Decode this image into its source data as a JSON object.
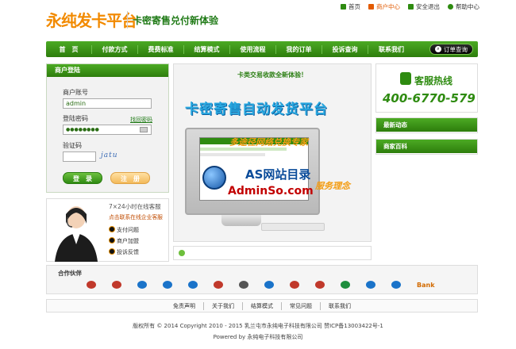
{
  "header": {
    "logo": "永纯发卡平台",
    "slogan": "卡密寄售兑付新体验",
    "links": [
      {
        "label": "首页",
        "icon": "home-icon",
        "color": "#2e8b10"
      },
      {
        "label": "商户中心",
        "icon": "user-icon",
        "color": "#e25a00"
      },
      {
        "label": "安全退出",
        "icon": "lock-icon",
        "color": "#2e8b10"
      },
      {
        "label": "帮助中心",
        "icon": "help-icon",
        "color": "#2e8b10"
      }
    ]
  },
  "nav": {
    "items": [
      "首　页",
      "付款方式",
      "费费标准",
      "结算模式",
      "使用流程",
      "我的订单",
      "投诉查询",
      "联系我们"
    ],
    "order_button": "订单查询"
  },
  "login": {
    "title": "商户登陆",
    "account_label": "商户账号",
    "account_value": "admin",
    "password_label": "登陆密码",
    "forgot": "找回密码",
    "password_value": "●●●●●●●●",
    "captcha_label": "验证码",
    "captcha_text": "jatu",
    "login_button": "登　录",
    "register_button": "注　册"
  },
  "service": {
    "hours": "7×24小时在线客服",
    "sub": "点击联系在线企业客服",
    "items": [
      "支付问题",
      "商户加盟",
      "投诉反馈"
    ]
  },
  "banner": {
    "top_text": "卡类交易收款全新体验！",
    "title": "卡密寄售自动发货平台",
    "tag1": "多途径网络兑换专家",
    "tag2": "服务理念",
    "watermark1": "AS网站目录",
    "watermark2": "AdminSo.com"
  },
  "hotline": {
    "title": "客服热线",
    "number": "400-6770-579"
  },
  "right_sections": [
    "最新动态",
    "商家百科"
  ],
  "partners": {
    "title": "合作伙伴",
    "logos": [
      "#c0392b",
      "#c0392b",
      "#1a73c9",
      "#1a73c9",
      "#1a73c9",
      "#c0392b",
      "#555",
      "#1a73c9",
      "#c0392b",
      "#c0392b",
      "#1e8e3e",
      "#1a73c9",
      "#1a73c9"
    ],
    "last_label": "Bank"
  },
  "footer": {
    "links": [
      "免责声明",
      "关于我们",
      "结算模式",
      "常见问题",
      "联系我们"
    ],
    "copyright": "版权所有 © 2014 Copyright 2010 - 2015 乳兰屯市永纯电子科技有限公司 赞ICP备13003422号-1",
    "powered": "Powered by 永纯电子科技有限公司"
  }
}
